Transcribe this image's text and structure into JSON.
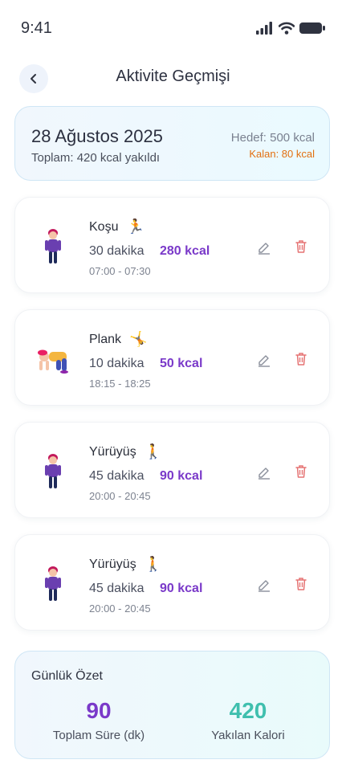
{
  "status_bar": {
    "time": "9:41"
  },
  "header": {
    "title": "Aktivite Geçmişi"
  },
  "summary": {
    "date": "28 Ağustos 2025",
    "total": "Toplam: 420 kcal yakıldı",
    "goal": "Hedef: 500 kcal",
    "remaining": "Kalan: 80 kcal"
  },
  "activities": [
    {
      "name": "Koşu",
      "emoji": "🏃",
      "duration": "30 dakika",
      "kcal": "280 kcal",
      "time_range": "07:00 - 07:30",
      "avatar": "standing-person"
    },
    {
      "name": "Plank",
      "emoji": "🤸",
      "duration": "10 dakika",
      "kcal": "50 kcal",
      "time_range": "18:15 - 18:25",
      "avatar": "plank-person"
    },
    {
      "name": "Yürüyüş",
      "emoji": "🚶",
      "duration": "45 dakika",
      "kcal": "90 kcal",
      "time_range": "20:00 - 20:45",
      "avatar": "standing-person"
    },
    {
      "name": "Yürüyüş",
      "emoji": "🚶",
      "duration": "45 dakika",
      "kcal": "90 kcal",
      "time_range": "20:00 - 20:45",
      "avatar": "standing-person"
    }
  ],
  "daily_summary": {
    "title": "Günlük Özet",
    "total_duration_value": "90",
    "total_duration_label": "Toplam Süre (dk)",
    "burned_calories_value": "420",
    "burned_calories_label": "Yakılan Kalori"
  },
  "colors": {
    "kcal": "#7a39c9",
    "remaining": "#e2700f",
    "duration_stat": "#7a39c9",
    "calorie_stat": "#3fbfae",
    "delete": "#e57373"
  }
}
